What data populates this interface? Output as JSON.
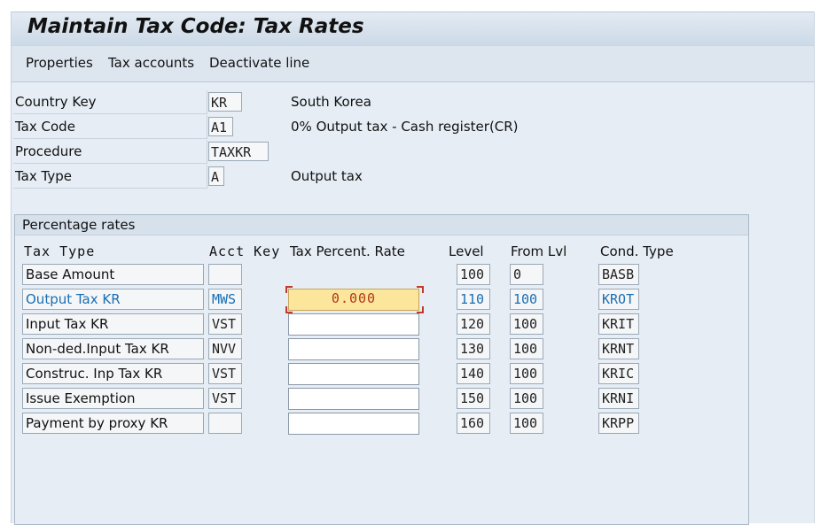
{
  "window": {
    "title": "Maintain Tax Code: Tax Rates"
  },
  "toolbar": {
    "buttons": [
      "Properties",
      "Tax accounts",
      "Deactivate line"
    ]
  },
  "header": {
    "country_key": {
      "label": "Country Key",
      "value": "KR",
      "description": "South Korea"
    },
    "tax_code": {
      "label": "Tax Code",
      "value": "A1",
      "description": "0% Output tax - Cash register(CR)"
    },
    "procedure": {
      "label": "Procedure",
      "value": "TAXKR",
      "description": ""
    },
    "tax_type": {
      "label": "Tax Type",
      "value": "A",
      "description": "Output tax"
    }
  },
  "rates": {
    "group_title": "Percentage rates",
    "columns": {
      "tax_type": "Tax Type",
      "acct_key": "Acct Key",
      "rate": "Tax Percent. Rate",
      "level": "Level",
      "from_lvl": "From Lvl",
      "cond_type": "Cond. Type"
    },
    "rows": [
      {
        "tax_type": "Base Amount",
        "acct_key": "",
        "rate": null,
        "level": "100",
        "from_lvl": "0",
        "cond_type": "BASB"
      },
      {
        "tax_type": "Output Tax KR",
        "acct_key": "MWS",
        "rate": "0.000",
        "level": "110",
        "from_lvl": "100",
        "cond_type": "KROT"
      },
      {
        "tax_type": "Input Tax KR",
        "acct_key": "VST",
        "rate": "",
        "level": "120",
        "from_lvl": "100",
        "cond_type": "KRIT"
      },
      {
        "tax_type": "Non-ded.Input Tax KR",
        "acct_key": "NVV",
        "rate": "",
        "level": "130",
        "from_lvl": "100",
        "cond_type": "KRNT"
      },
      {
        "tax_type": "Construc. Inp Tax KR",
        "acct_key": "VST",
        "rate": "",
        "level": "140",
        "from_lvl": "100",
        "cond_type": "KRIC"
      },
      {
        "tax_type": "Issue Exemption",
        "acct_key": "VST",
        "rate": "",
        "level": "150",
        "from_lvl": "100",
        "cond_type": "KRNI"
      },
      {
        "tax_type": "Payment by proxy KR",
        "acct_key": "",
        "rate": "",
        "level": "160",
        "from_lvl": "100",
        "cond_type": "KRPP"
      }
    ]
  }
}
